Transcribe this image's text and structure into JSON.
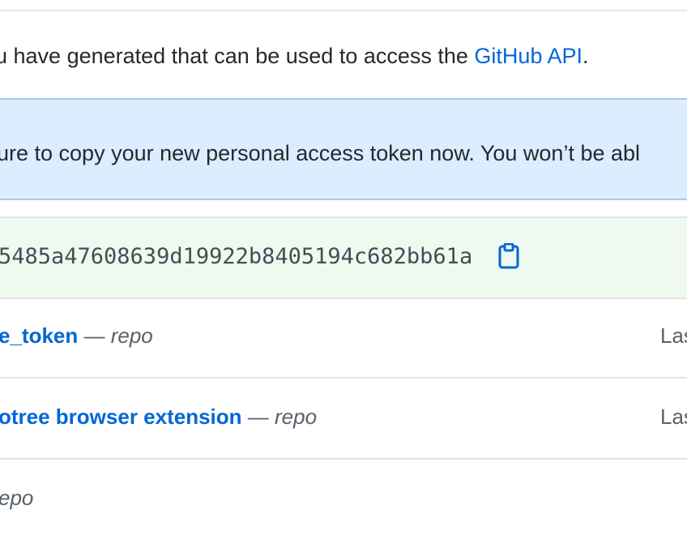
{
  "intro": {
    "text": "u have generated that can be used to access the ",
    "link": "GitHub API",
    "suffix": "."
  },
  "flash": {
    "message": "ure to copy your new personal access token now. You won’t be abl"
  },
  "new_token": {
    "value": "5485a47608639d19922b8405194c682bb61a",
    "copy_icon": "clipboard-icon",
    "accent_color": "#0366d6",
    "background_color": "#f0f9ef"
  },
  "tokens": [
    {
      "name": "e_token",
      "separator": " — ",
      "scope": "repo",
      "last_used": "Las"
    },
    {
      "name": "otree browser extension",
      "separator": " — ",
      "scope": "repo",
      "last_used": "Las"
    },
    {
      "scope": "epo"
    }
  ]
}
